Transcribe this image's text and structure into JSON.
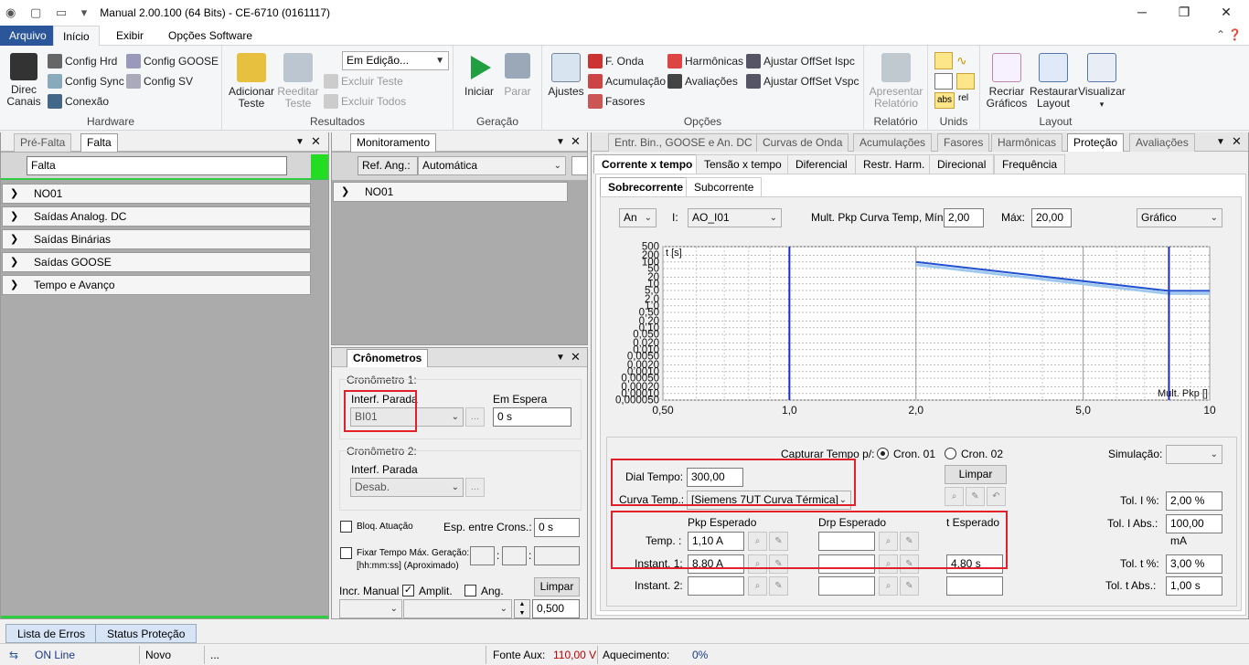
{
  "window": {
    "title": "Manual 2.00.100 (64 Bits) - CE-6710 (0161117)",
    "min": "─",
    "restore": "❐",
    "close": "✕"
  },
  "ribbon_tabs": [
    "Arquivo",
    "Início",
    "Exibir",
    "Opções Software"
  ],
  "ribbon": {
    "hardware": {
      "label": "Hardware",
      "direc": "Direc\nCanais",
      "config_hrd": "Config Hrd",
      "config_sync": "Config Sync",
      "conexao": "Conexão",
      "config_goose": "Config GOOSE",
      "config_sv": "Config SV"
    },
    "resultados": {
      "label": "Resultados",
      "adicionar": "Adicionar\nTeste",
      "reeditar": "Reeditar\nTeste",
      "em_edicao": "Em Edição...",
      "excluir_teste": "Excluir Teste",
      "excluir_todos": "Excluir Todos"
    },
    "geracao": {
      "label": "Geração",
      "iniciar": "Iniciar",
      "parar": "Parar"
    },
    "opcoes": {
      "label": "Opções",
      "ajustes": "Ajustes",
      "f_onda": "F. Onda",
      "acumulacao": "Acumulação",
      "fasores": "Fasores",
      "harmonicas": "Harmônicas",
      "avaliacoes": "Avaliações",
      "offset_ispc": "Ajustar OffSet Ispc",
      "offset_vspc": "Ajustar OffSet Vspc"
    },
    "relatorio": {
      "label": "Relatório",
      "apresentar": "Apresentar\nRelatório"
    },
    "unids": {
      "label": "Unids",
      "abs": "abs",
      "rel": "rel"
    },
    "layout": {
      "label": "Layout",
      "recriar": "Recriar\nGráficos",
      "restaurar": "Restaurar\nLayout",
      "visualizar": "Visualizar"
    }
  },
  "left_panel": {
    "tabs": [
      "Pré-Falta",
      "Falta"
    ],
    "name_value": "Falta",
    "sections": [
      "NO01",
      "Saídas Analog. DC",
      "Saídas Binárias",
      "Saídas GOOSE",
      "Tempo e Avanço"
    ]
  },
  "monitor_panel": {
    "tab": "Monitoramento",
    "ref_label": "Ref. Ang.:",
    "ref_value": "Automática",
    "section": "NO01"
  },
  "cron_panel": {
    "tab": "Crônometros",
    "c1": "Cronômetro 1:",
    "c1_interf": "Interf. Parada",
    "c1_value": "BI01",
    "espera_label": "Em Espera",
    "espera_value": "0 s",
    "c2": "Cronômetro 2:",
    "c2_interf": "Interf. Parada",
    "c2_value": "Desab.",
    "bloq": "Bloq. Atuação",
    "esp_label": "Esp. entre Crons.:",
    "esp_value": "0 s",
    "fixar": "Fixar Tempo Máx. Geração:",
    "fixar_fmt": "[hh:mm:ss] (Aproximado)",
    "sep": ":",
    "incr": "Incr. Manual",
    "amplit": "Amplit.",
    "ang": "Ang.",
    "limpar": "Limpar",
    "step_value": "0,500"
  },
  "right_panel": {
    "tabs": [
      "Entr. Bin., GOOSE e An. DC",
      "Curvas de Onda",
      "Acumulações",
      "Fasores",
      "Harmônicas",
      "Proteção",
      "Avaliações"
    ],
    "subtabs": [
      "Corrente x tempo",
      "Tensão x tempo",
      "Diferencial",
      "Restr. Harm.",
      "Direcional",
      "Frequência"
    ],
    "subtabs2": [
      "Sobrecorrente",
      "Subcorrente"
    ],
    "an_value": "An",
    "i_label": "I:",
    "i_value": "AO_I01",
    "mult_label": "Mult. Pkp Curva Temp, Mín:",
    "mult_min": "2,00",
    "max_label": "Máx:",
    "mult_max": "20,00",
    "view_value": "Gráfico",
    "capturar": "Capturar Tempo p/:",
    "cron01": "Cron. 01",
    "cron02": "Cron. 02",
    "simulacao": "Simulação:",
    "dial_label": "Dial Tempo:",
    "dial_value": "300,00",
    "curva_label": "Curva Temp.:",
    "curva_value": "[Siemens 7UT Curva Térmica]",
    "limpar": "Limpar",
    "tol_i_pct": "Tol. I %:",
    "tol_i_pct_value": "2,00 %",
    "tol_i_abs": "Tol. I Abs.:",
    "tol_i_abs_value": "100,00 mA",
    "tol_t_pct": "Tol. t %:",
    "tol_t_pct_value": "3,00 %",
    "tol_t_abs": "Tol. t Abs.:",
    "tol_t_abs_value": "1,00 s",
    "col_pkp": "Pkp Esperado",
    "col_drp": "Drp Esperado",
    "col_t": "t Esperado",
    "row_temp": "Temp. :",
    "row_inst1": "Instant. 1:",
    "row_inst2": "Instant. 2:",
    "temp_pkp": "1,10 A",
    "inst1_pkp": "8,80 A",
    "inst1_t": "4,80 s"
  },
  "chart_data": {
    "type": "line",
    "ylabel": "t [s]",
    "xlabel": "Mult. Pkp []",
    "x_scale": "log",
    "y_scale": "log",
    "x_ticks": [
      "0,50",
      "1,0",
      "2,0",
      "5,0",
      "10"
    ],
    "x_tick_values": [
      0.5,
      1,
      2,
      5,
      10
    ],
    "y_ticks": [
      "500",
      "200",
      "100",
      "50",
      "20",
      "10",
      "5,0",
      "2,0",
      "1,0",
      "0,50",
      "0,20",
      "0,10",
      "0,050",
      "0,020",
      "0,010",
      "0,0050",
      "0,0020",
      "0,0010",
      "0,00050",
      "0,00020",
      "0,00010",
      "0,000050"
    ],
    "y_tick_values": [
      500,
      200,
      100,
      50,
      20,
      10,
      5,
      2,
      1,
      0.5,
      0.2,
      0.1,
      0.05,
      0.02,
      0.01,
      0.005,
      0.002,
      0.001,
      0.0005,
      0.0002,
      0.0001,
      5e-05
    ],
    "xlim": [
      0.5,
      10
    ],
    "ylim": [
      5e-05,
      500
    ],
    "grid": true,
    "series": [
      {
        "x": [
          2.0,
          8.0,
          10.0
        ],
        "y": [
          100,
          4.8,
          4.8
        ]
      }
    ],
    "vlines": [
      1.0,
      8.0
    ],
    "colors": {
      "curve": "#2050d0",
      "vline": "#1a2bc8",
      "tol": "#9ec8ee"
    }
  },
  "bottom_tabs": [
    "Lista de Erros",
    "Status Proteção"
  ],
  "status": {
    "online": "ON Line",
    "novo": "Novo",
    "dots": "...",
    "fonte_label": "Fonte Aux:",
    "fonte_value": "110,00 V",
    "aquec_label": "Aquecimento:",
    "aquec_value": "0%"
  }
}
